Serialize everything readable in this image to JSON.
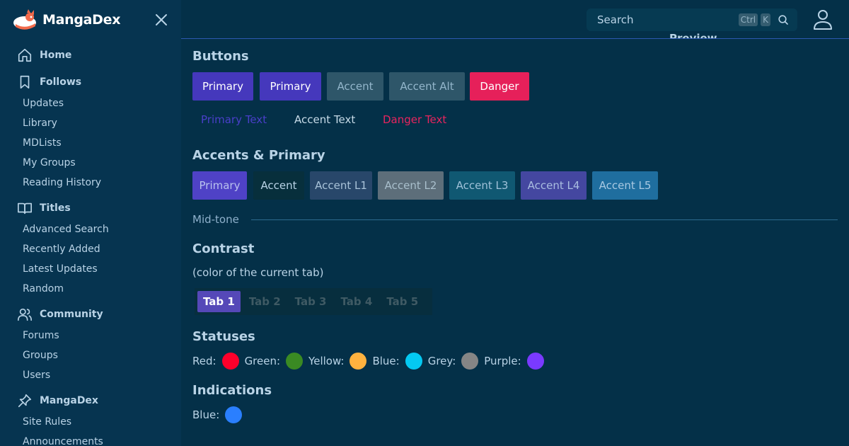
{
  "brand": {
    "name": "MangaDex"
  },
  "sidebar": {
    "sections": [
      {
        "label": "Home",
        "icon": "home-icon",
        "items": []
      },
      {
        "label": "Follows",
        "icon": "bookmark-icon",
        "items": [
          "Updates",
          "Library",
          "MDLists",
          "My Groups",
          "Reading History"
        ]
      },
      {
        "label": "Titles",
        "icon": "book-open-icon",
        "items": [
          "Advanced Search",
          "Recently Added",
          "Latest Updates",
          "Random"
        ]
      },
      {
        "label": "Community",
        "icon": "users-icon",
        "items": [
          "Forums",
          "Groups",
          "Users"
        ]
      },
      {
        "label": "MangaDex",
        "icon": "pin-icon",
        "items": [
          "Site Rules",
          "Announcements"
        ]
      }
    ]
  },
  "header": {
    "search_placeholder": "Search",
    "shortcut_ctrl": "Ctrl",
    "shortcut_key": "K",
    "preview_heading": "Preview"
  },
  "buttons": {
    "heading": "Buttons",
    "solid": [
      {
        "label": "Primary",
        "bg": "#4538bc",
        "fg": "#ffffff"
      },
      {
        "label": "Primary",
        "bg": "#4538bc",
        "fg": "#ffffff"
      },
      {
        "label": "Accent",
        "bg": "#2e5669",
        "fg": "#93b6cb"
      },
      {
        "label": "Accent Alt",
        "bg": "#2e5669",
        "fg": "#93b6cb"
      },
      {
        "label": "Danger",
        "bg": "#e6205a",
        "fg": "#ffffff"
      }
    ],
    "text": [
      {
        "label": "Primary Text",
        "color": "#4a3fc9"
      },
      {
        "label": "Accent Text",
        "color": "#c7dbe8"
      },
      {
        "label": "Danger Text",
        "color": "#e8245e"
      }
    ]
  },
  "accents": {
    "heading": "Accents & Primary",
    "swatches": [
      {
        "label": "Primary",
        "bg": "#4f42c6",
        "fg": "#b9c2ee"
      },
      {
        "label": "Accent",
        "bg": "#072f3c",
        "fg": "#b9d3e6"
      },
      {
        "label": "Accent L1",
        "bg": "#28476a",
        "fg": "#a9c3d9"
      },
      {
        "label": "Accent L2",
        "bg": "#5d6e7a",
        "fg": "#a9bfcc"
      },
      {
        "label": "Accent L3",
        "bg": "#105872",
        "fg": "#9fc1d8"
      },
      {
        "label": "Accent L4",
        "bg": "#4447a0",
        "fg": "#a9bde0"
      },
      {
        "label": "Accent L5",
        "bg": "#1f6e9f",
        "fg": "#a9c9e2"
      }
    ],
    "midtone_label": "Mid-tone"
  },
  "contrast": {
    "heading": "Contrast",
    "subtitle": "(color of the current tab)",
    "tabs": [
      "Tab 1",
      "Tab 2",
      "Tab 3",
      "Tab 4",
      "Tab 5"
    ],
    "active_tab": "Tab 1"
  },
  "statuses": {
    "heading": "Statuses",
    "items": [
      {
        "label": "Red:",
        "color": "#ff002b"
      },
      {
        "label": "Green:",
        "color": "#3a8a23"
      },
      {
        "label": "Yellow:",
        "color": "#ffb23f"
      },
      {
        "label": "Blue:",
        "color": "#04c9f2"
      },
      {
        "label": "Grey:",
        "color": "#858585"
      },
      {
        "label": "Purple:",
        "color": "#7a3aff"
      }
    ]
  },
  "indications": {
    "heading": "Indications",
    "items": [
      {
        "label": "Blue:",
        "color": "#2a7fff"
      }
    ]
  }
}
